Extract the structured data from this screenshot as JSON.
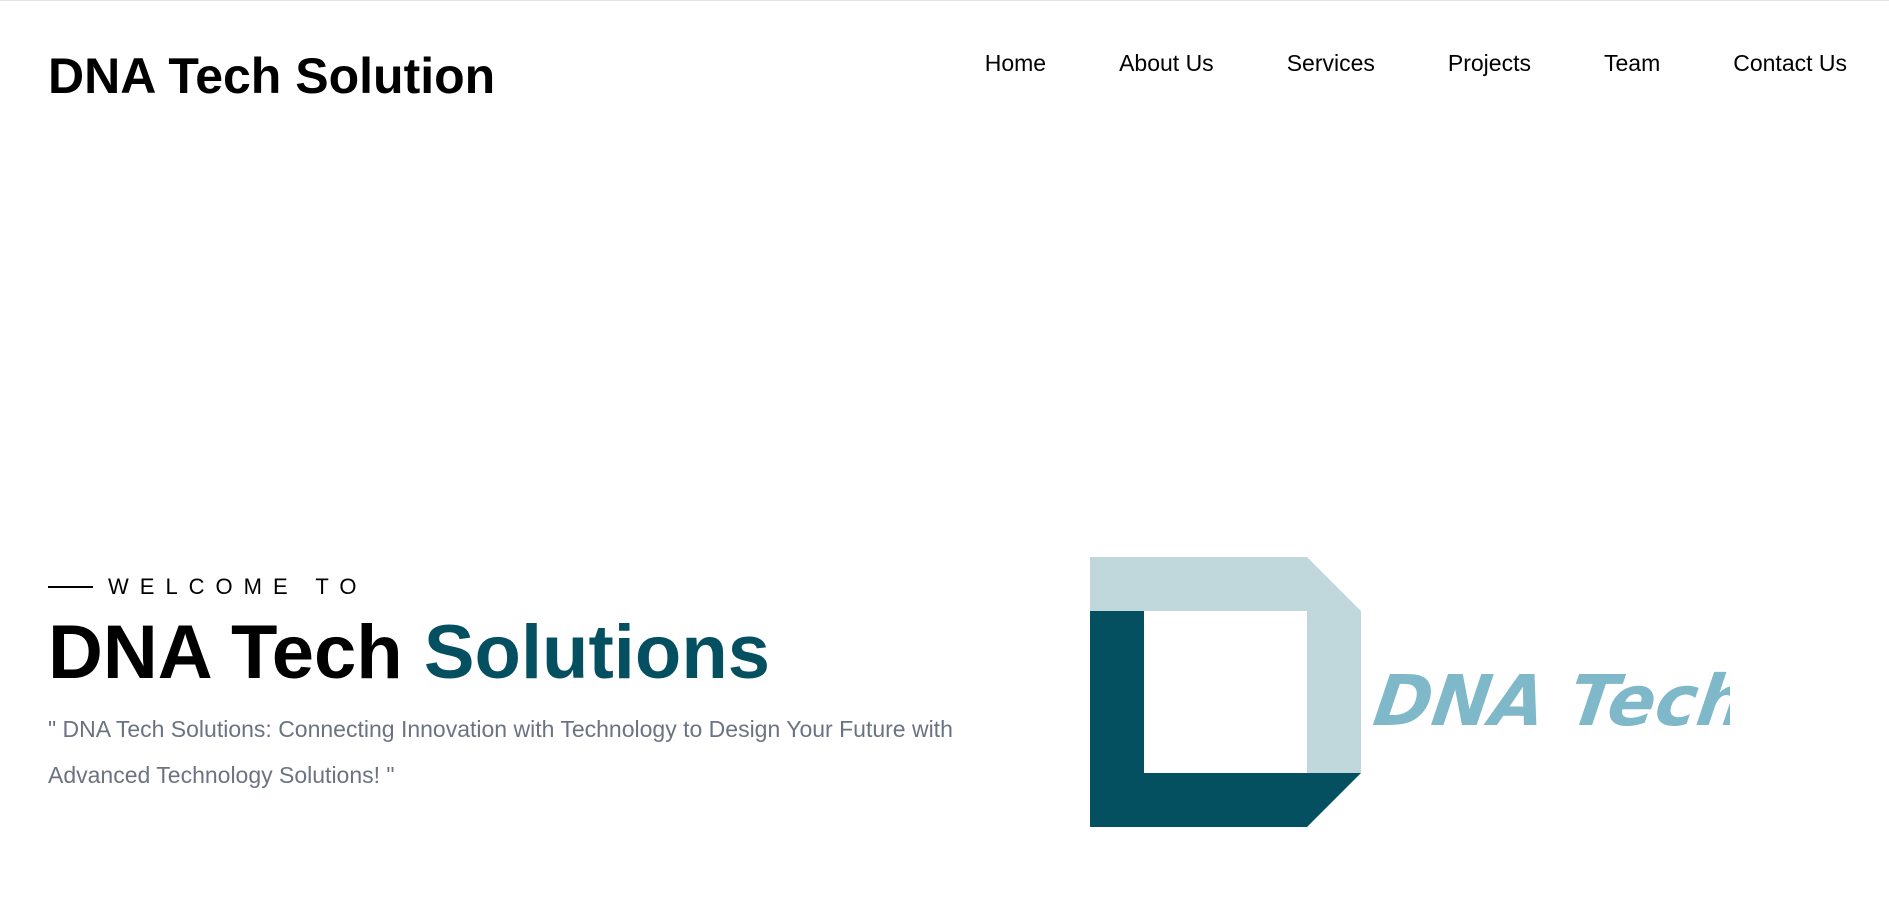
{
  "header": {
    "brand": "DNA Tech Solution",
    "nav": [
      {
        "label": "Home"
      },
      {
        "label": "About Us"
      },
      {
        "label": "Services"
      },
      {
        "label": "Projects"
      },
      {
        "label": "Team"
      },
      {
        "label": "Contact Us"
      }
    ]
  },
  "hero": {
    "eyebrow": "WELCOME TO",
    "title_main": "DNA Tech",
    "title_accent": "Solutions",
    "tagline": "\" DNA Tech Solutions: Connecting Innovation with Technology to Design Your Future with Advanced Technology Solutions! \""
  },
  "logo": {
    "text": "DNA Tech",
    "colors": {
      "light": "#c0d8dc",
      "dark": "#045061",
      "text": "#7fb8c9"
    }
  },
  "colors": {
    "accent": "#045061",
    "tagline": "#6b7382"
  }
}
